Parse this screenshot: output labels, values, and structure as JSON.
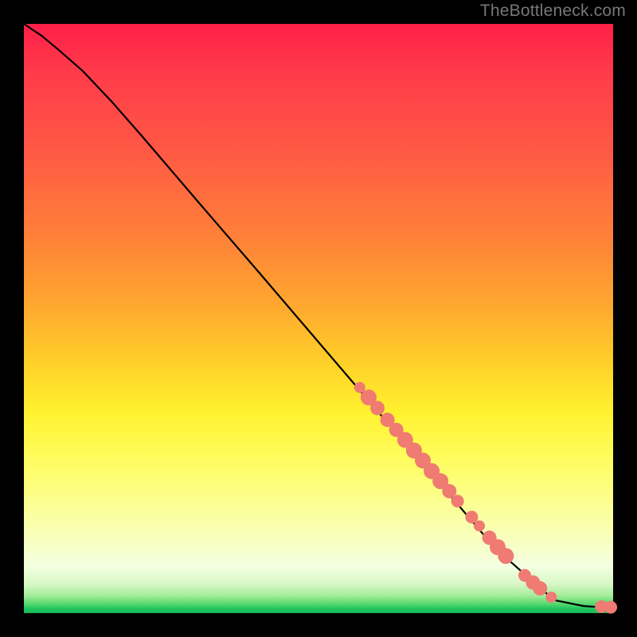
{
  "watermark": "TheBottleneck.com",
  "colors": {
    "background": "#000000",
    "curve": "#000000",
    "marker_fill": "#ef7b72",
    "marker_stroke": "#d9655c",
    "watermark_text": "#777777"
  },
  "chart_data": {
    "type": "line",
    "title": "",
    "xlabel": "",
    "ylabel": "",
    "xlim": [
      0,
      100
    ],
    "ylim": [
      0,
      100
    ],
    "series": [
      {
        "name": "curve",
        "x": [
          0,
          3,
          6,
          10,
          15,
          20,
          30,
          40,
          50,
          60,
          70,
          80,
          90,
          95,
          96.5,
          98,
          100
        ],
        "y": [
          100,
          98,
          95.5,
          92,
          86.7,
          81,
          69.3,
          57.7,
          46,
          34.3,
          22.7,
          11,
          2.2,
          1.2,
          1.1,
          1.05,
          1
        ]
      }
    ],
    "markers": [
      {
        "x": 57.0,
        "y": 38.3,
        "r": 7
      },
      {
        "x": 58.5,
        "y": 36.6,
        "r": 10
      },
      {
        "x": 60.0,
        "y": 34.8,
        "r": 9
      },
      {
        "x": 61.7,
        "y": 32.8,
        "r": 9
      },
      {
        "x": 63.2,
        "y": 31.1,
        "r": 9
      },
      {
        "x": 64.7,
        "y": 29.4,
        "r": 10
      },
      {
        "x": 66.2,
        "y": 27.6,
        "r": 10
      },
      {
        "x": 67.7,
        "y": 25.9,
        "r": 10
      },
      {
        "x": 69.2,
        "y": 24.1,
        "r": 10
      },
      {
        "x": 70.7,
        "y": 22.4,
        "r": 10
      },
      {
        "x": 72.2,
        "y": 20.7,
        "r": 9
      },
      {
        "x": 73.6,
        "y": 19.0,
        "r": 8
      },
      {
        "x": 76.0,
        "y": 16.3,
        "r": 8
      },
      {
        "x": 77.3,
        "y": 14.8,
        "r": 7
      },
      {
        "x": 79.0,
        "y": 12.8,
        "r": 9
      },
      {
        "x": 80.4,
        "y": 11.2,
        "r": 10
      },
      {
        "x": 81.8,
        "y": 9.7,
        "r": 10
      },
      {
        "x": 85.0,
        "y": 6.4,
        "r": 8
      },
      {
        "x": 86.4,
        "y": 5.2,
        "r": 9
      },
      {
        "x": 87.6,
        "y": 4.2,
        "r": 9
      },
      {
        "x": 89.5,
        "y": 2.7,
        "r": 7
      },
      {
        "x": 98.0,
        "y": 1.1,
        "r": 8
      },
      {
        "x": 99.6,
        "y": 1.0,
        "r": 8
      }
    ],
    "gradient_stops": [
      {
        "pos": 0.0,
        "color": "#ff1f48"
      },
      {
        "pos": 0.08,
        "color": "#ff3a4a"
      },
      {
        "pos": 0.22,
        "color": "#ff5a44"
      },
      {
        "pos": 0.36,
        "color": "#ff8038"
      },
      {
        "pos": 0.48,
        "color": "#ffa92f"
      },
      {
        "pos": 0.58,
        "color": "#ffd229"
      },
      {
        "pos": 0.66,
        "color": "#fff22f"
      },
      {
        "pos": 0.74,
        "color": "#fffd60"
      },
      {
        "pos": 0.82,
        "color": "#fbff96"
      },
      {
        "pos": 0.88,
        "color": "#f8ffc3"
      },
      {
        "pos": 0.92,
        "color": "#f4ffe0"
      },
      {
        "pos": 0.95,
        "color": "#d8f8c8"
      },
      {
        "pos": 0.97,
        "color": "#a6ec9a"
      },
      {
        "pos": 0.985,
        "color": "#52d76c"
      },
      {
        "pos": 0.993,
        "color": "#1fc45f"
      },
      {
        "pos": 1.0,
        "color": "#18b85a"
      }
    ]
  }
}
